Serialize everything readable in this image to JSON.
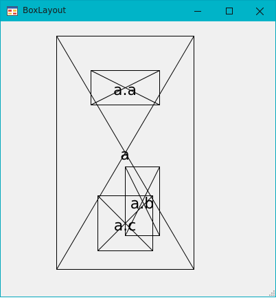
{
  "window": {
    "title": "BoxLayout",
    "icon": "form-app-icon"
  },
  "caption_buttons": {
    "minimize_icon": "minimize-icon",
    "maximize_icon": "maximize-icon",
    "close_icon": "close-icon"
  },
  "boxes": {
    "outer": {
      "label": "a"
    },
    "aa": {
      "label": "a.a"
    },
    "ab": {
      "label": "a.b"
    },
    "ac": {
      "label": "a.c"
    }
  },
  "colors": {
    "titlebar": "#00b4c8",
    "client_background": "#f0f0f0",
    "stroke": "#000000"
  }
}
